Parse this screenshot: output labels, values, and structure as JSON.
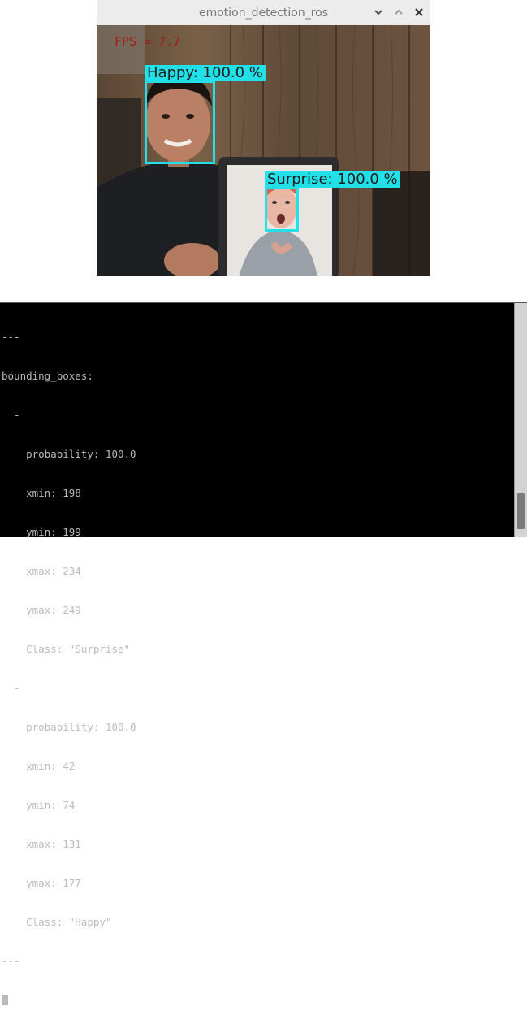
{
  "window": {
    "title": "emotion_detection_ros",
    "controls": [
      {
        "name": "minimize-button",
        "icon": "chevron-down-icon"
      },
      {
        "name": "maximize-button",
        "icon": "chevron-up-icon"
      },
      {
        "name": "close-button",
        "icon": "close-icon"
      }
    ]
  },
  "video": {
    "fps_text": "FPS = 7.7",
    "detections": [
      {
        "label": "Happy: 100.0 %",
        "color": "#22e0e8"
      },
      {
        "label": "Surprise: 100.0 %",
        "color": "#22e0e8"
      }
    ]
  },
  "terminal": {
    "lines": [
      "---",
      "bounding_boxes:",
      "  -",
      "    probability: 100.0",
      "    xmin: 198",
      "    ymin: 199",
      "    xmax: 234",
      "    ymax: 249",
      "    Class: \"Surprise\"",
      "  -",
      "    probability: 100.0",
      "    xmin: 42",
      "    ymin: 74",
      "    xmax: 131",
      "    ymax: 177",
      "    Class: \"Happy\"",
      "---"
    ]
  }
}
